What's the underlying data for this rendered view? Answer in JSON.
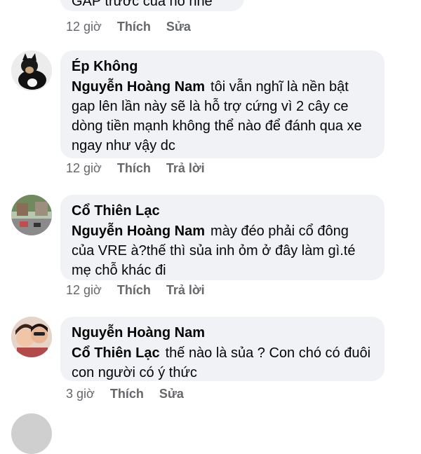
{
  "comments": [
    {
      "text": "GAP trước của nó nhé",
      "time": "12 giờ",
      "actions": [
        "Thích",
        "Sửa"
      ]
    },
    {
      "author": "Ép Không",
      "mention": "Nguyễn Hoàng Nam",
      "text": "tôi vẫn nghĩ là nền bật gap lên lần này sẽ là hỗ trợ cứng vì 2 cây ce dòng tiền mạnh không thể nào để đánh qua xe ngay như vậy dc",
      "time": "12 giờ",
      "actions": [
        "Thích",
        "Trả lời"
      ]
    },
    {
      "author": "Cổ Thiên Lạc",
      "mention": "Nguyễn Hoàng Nam",
      "text": "mày đéo phải cổ đông của VRE à?thế thì sủa inh ỏm ở đây làm gì.té mẹ chỗ khác đi",
      "time": "12 giờ",
      "actions": [
        "Thích",
        "Trả lời"
      ]
    },
    {
      "author": "Nguyễn Hoàng Nam",
      "mention": "Cổ Thiên Lạc",
      "text": "thế nào là sủa ? Con chó có đuôi con người có ý thức",
      "time": "3 giờ",
      "actions": [
        "Thích",
        "Sửa"
      ]
    }
  ]
}
